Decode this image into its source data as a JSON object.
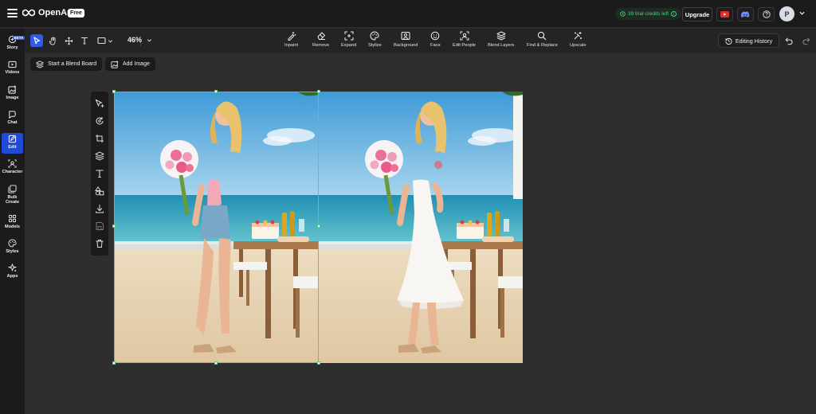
{
  "header": {
    "logo_text": "OpenArt",
    "badge": "Free",
    "credits_text": "39 trial credits left",
    "upgrade_label": "Upgrade",
    "avatar_letter": "P",
    "icons": [
      "menu-icon",
      "youtube-icon",
      "discord-icon",
      "help-icon",
      "chevron-down-icon"
    ]
  },
  "sidebar": {
    "beta_badge": "BETA",
    "items": [
      {
        "label": "Story",
        "icon": "story-icon"
      },
      {
        "label": "Videos",
        "icon": "video-icon"
      },
      {
        "label": "Image",
        "icon": "image-icon"
      },
      {
        "label": "Chat",
        "icon": "chat-icon"
      },
      {
        "label": "Edit",
        "icon": "edit-icon",
        "active": true
      },
      {
        "label": "Character",
        "icon": "character-icon"
      },
      {
        "label": "Bulk Create",
        "icon": "bulk-create-icon"
      },
      {
        "label": "Models",
        "icon": "models-icon"
      },
      {
        "label": "Styles",
        "icon": "styles-icon"
      },
      {
        "label": "Apps",
        "icon": "apps-icon"
      }
    ]
  },
  "toolbar": {
    "zoom": "46%",
    "tools": [
      {
        "label": "Inpaint",
        "icon": "inpaint-icon"
      },
      {
        "label": "Remove",
        "icon": "eraser-icon"
      },
      {
        "label": "Expand",
        "icon": "expand-icon"
      },
      {
        "label": "Stylize",
        "icon": "palette-icon"
      },
      {
        "label": "Background",
        "icon": "background-icon"
      },
      {
        "label": "Face",
        "icon": "face-icon"
      },
      {
        "label": "Edit People",
        "icon": "edit-people-icon"
      },
      {
        "label": "Blend Layers",
        "icon": "layers-icon"
      },
      {
        "label": "Find & Replace",
        "icon": "search-icon"
      },
      {
        "label": "Upscale",
        "icon": "upscale-icon"
      }
    ],
    "editing_history": "Editing History"
  },
  "canvas": {
    "blend_board_label": "Start a Blend Board",
    "add_image_label": "Add Image"
  },
  "colors": {
    "accent": "#1f4bd8",
    "selection": "#4bd07b",
    "credits": "#4cd37a"
  }
}
